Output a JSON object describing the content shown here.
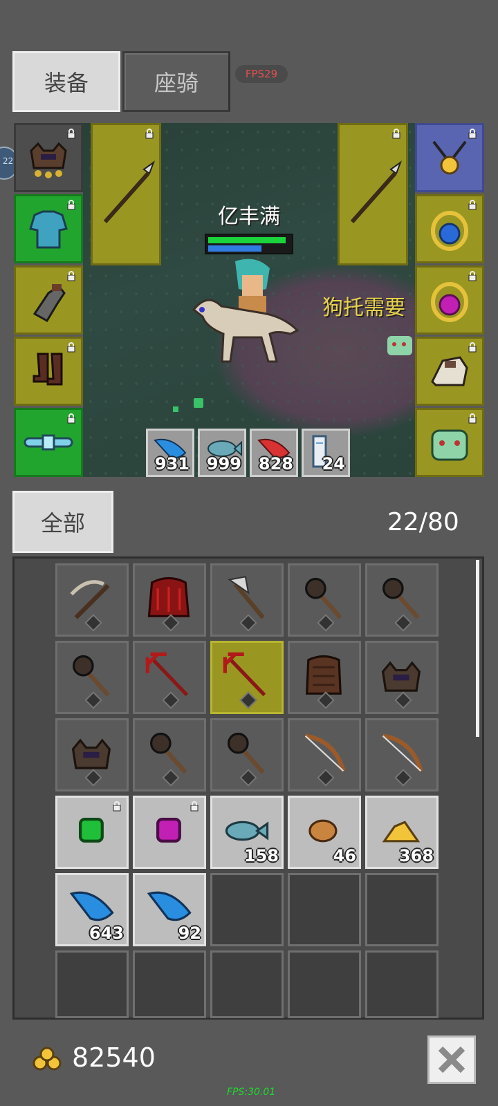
{
  "tabs": {
    "equipment": "装备",
    "mount": "座骑"
  },
  "fps_badge": "FPS29",
  "side_bubble": "22",
  "character": {
    "name": "亿丰满",
    "hp_fraction": 0.95,
    "mp_fraction": 0.65
  },
  "overlay_text": "狗托需要",
  "quick_items": [
    {
      "icon": "blue-feather-icon",
      "qty": "931"
    },
    {
      "icon": "fish-icon",
      "qty": "999"
    },
    {
      "icon": "red-feather-icon",
      "qty": "828"
    },
    {
      "icon": "scroll-icon",
      "qty": "24"
    }
  ],
  "filter": {
    "label": "全部"
  },
  "inventory": {
    "count": "22/80"
  },
  "inventory_items": [
    {
      "icon": "crossbow-icon",
      "qty": ""
    },
    {
      "icon": "red-armor-icon",
      "qty": ""
    },
    {
      "icon": "axe-icon",
      "qty": ""
    },
    {
      "icon": "mace-icon",
      "qty": ""
    },
    {
      "icon": "mace-icon",
      "qty": ""
    },
    {
      "icon": "mace-icon",
      "qty": ""
    },
    {
      "icon": "trident-icon",
      "qty": ""
    },
    {
      "icon": "trident-icon",
      "qty": ""
    },
    {
      "icon": "leather-armor-icon",
      "qty": ""
    },
    {
      "icon": "horned-helmet-icon",
      "qty": ""
    },
    {
      "icon": "horned-helmet-icon",
      "qty": ""
    },
    {
      "icon": "mace-icon",
      "qty": ""
    },
    {
      "icon": "mace-icon",
      "qty": ""
    },
    {
      "icon": "bow-icon",
      "qty": ""
    },
    {
      "icon": "bow-icon",
      "qty": ""
    },
    {
      "icon": "green-gem-icon",
      "qty": ""
    },
    {
      "icon": "purple-gem-icon",
      "qty": ""
    },
    {
      "icon": "fish-icon",
      "qty": "158"
    },
    {
      "icon": "meat-icon",
      "qty": "46"
    },
    {
      "icon": "gold-pile-icon",
      "qty": "368"
    },
    {
      "icon": "blue-feather-icon",
      "qty": "643"
    },
    {
      "icon": "blue-feather-icon",
      "qty": "92"
    }
  ],
  "gold": {
    "amount": "82540",
    "icon": "gold-coins-icon"
  },
  "fps_footer": "FPS:30.01",
  "colors": {
    "slot_green": "#22a52e",
    "slot_yellow": "#9a9622",
    "slot_blue": "#5965b0",
    "hp": "#1bd43c",
    "mp": "#2f7de0"
  }
}
